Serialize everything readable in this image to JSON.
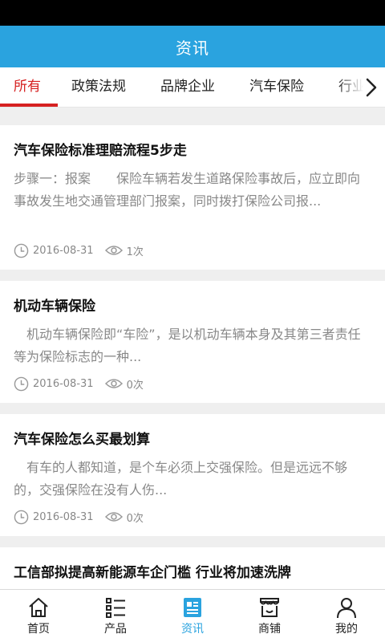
{
  "header": {
    "title": "资讯"
  },
  "tabs": [
    {
      "label": "所有",
      "active": true
    },
    {
      "label": "政策法规",
      "active": false
    },
    {
      "label": "品牌企业",
      "active": false
    },
    {
      "label": "汽车保险",
      "active": false
    },
    {
      "label": "行业",
      "active": false
    }
  ],
  "articles": [
    {
      "title": "汽车保险标准理赔流程5步走",
      "summary": "步骤一：报案　　保险车辆若发生道路保险事故后，应立即向事故发生地交通管理部门报案，同时拨打保险公司报...",
      "date": "2016-08-31",
      "views": "1次"
    },
    {
      "title": "机动车辆保险",
      "summary": "　机动车辆保险即“车险”，是以机动车辆本身及其第三者责任等为保险标志的一种...",
      "date": "2016-08-31",
      "views": "0次"
    },
    {
      "title": "汽车保险怎么买最划算",
      "summary": "　有车的人都知道，是个车必须上交强保险。但是远远不够的，交强保险在没有人伤...",
      "date": "2016-08-31",
      "views": "0次"
    },
    {
      "title": "工信部拟提高新能源车企门槛 行业将加速洗牌",
      "summary": "",
      "date": "",
      "views": ""
    }
  ],
  "bottom_nav": [
    {
      "label": "首页",
      "icon": "home-icon",
      "active": false
    },
    {
      "label": "产品",
      "icon": "product-list-icon",
      "active": false
    },
    {
      "label": "资讯",
      "icon": "news-icon",
      "active": true
    },
    {
      "label": "商铺",
      "icon": "shop-icon",
      "active": false
    },
    {
      "label": "我的",
      "icon": "user-icon",
      "active": false
    }
  ],
  "colors": {
    "primary": "#2aa3df",
    "active_tab": "#d62121",
    "background": "#efefef",
    "muted_text": "#888888"
  }
}
